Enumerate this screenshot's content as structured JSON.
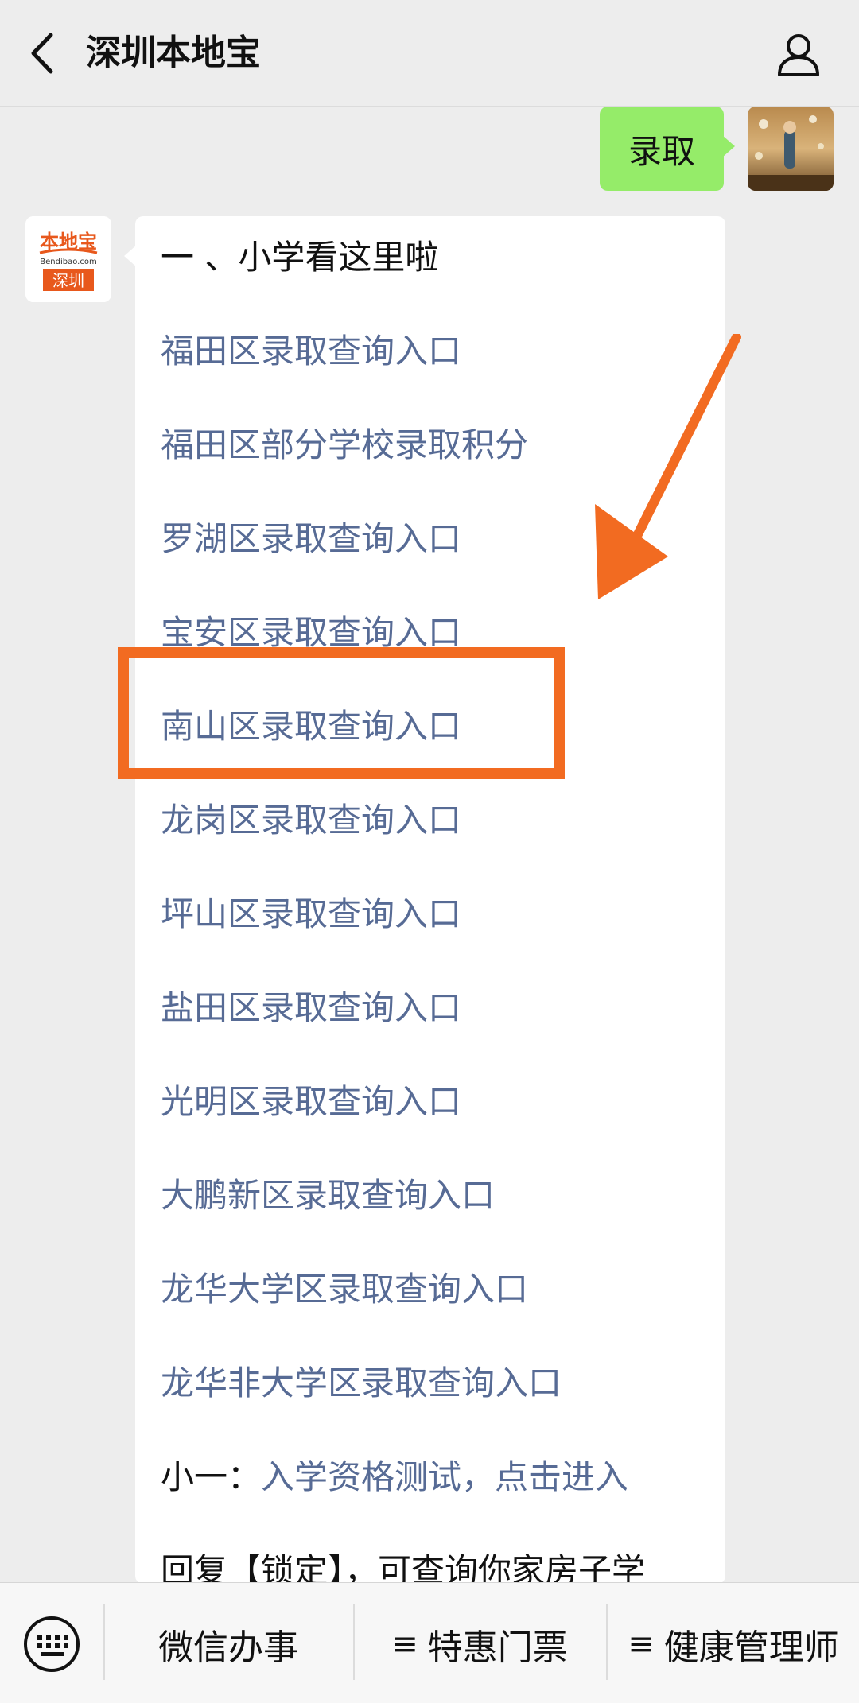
{
  "header": {
    "title": "深圳本地宝"
  },
  "chat": {
    "sent_message": "录取",
    "bot_avatar": {
      "logo_text": "本地宝",
      "logo_sub": "Bendibao.com",
      "logo_city": "深圳"
    },
    "message": {
      "heading": "一 、小学看这里啦",
      "links": [
        "福田区录取查询入口",
        "福田区部分学校录取积分",
        "罗湖区录取查询入口",
        "宝安区录取查询入口",
        "南山区录取查询入口",
        "龙岗区录取查询入口",
        "坪山区录取查询入口",
        "盐田区录取查询入口",
        "光明区录取查询入口",
        "大鹏新区录取查询入口",
        "龙华大学区录取查询入口",
        "龙华非大学区录取查询入口"
      ],
      "test_prefix": "小一：",
      "test_link": "入学资格测试，点击进入",
      "last_line": "回复【锁定】，可查询你家房子学"
    }
  },
  "bottom_menu": {
    "items": [
      {
        "prefix": "",
        "label": "微信办事"
      },
      {
        "prefix": "≡",
        "label": "特惠门票"
      },
      {
        "prefix": "≡",
        "label": "健康管理师"
      }
    ]
  },
  "colors": {
    "link": "#576b95",
    "sent_bubble": "#95ec69",
    "highlight": "#f26b21"
  }
}
